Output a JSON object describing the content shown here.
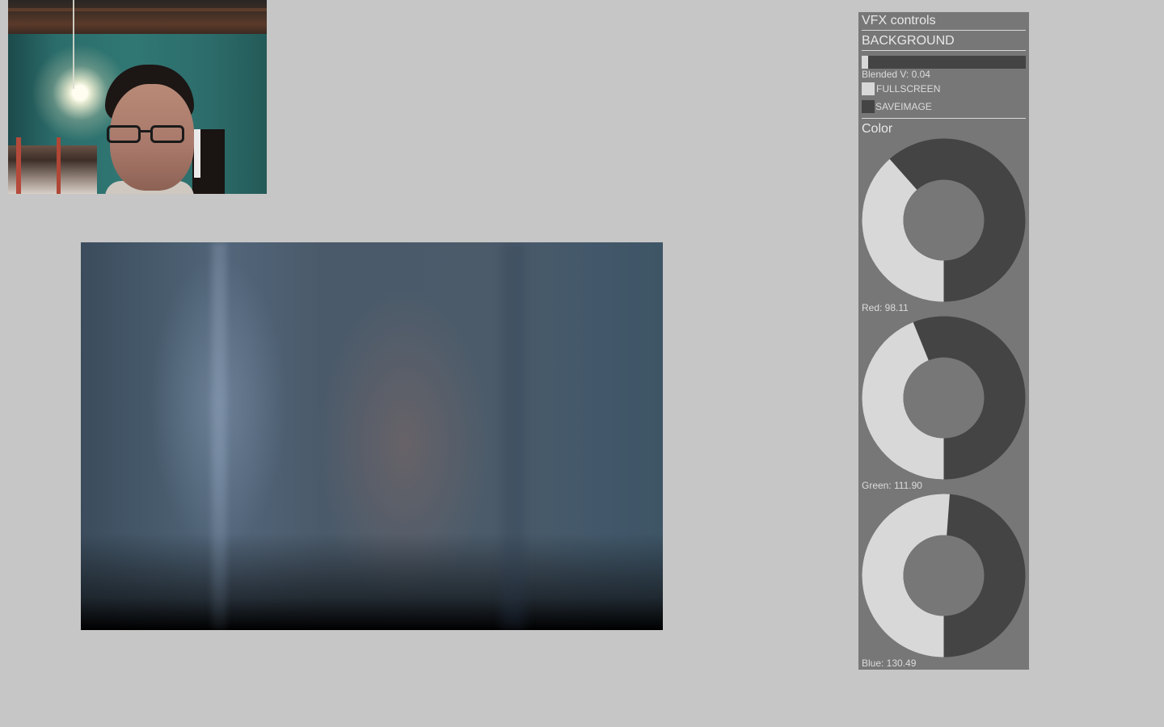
{
  "panel": {
    "title": "VFX controls",
    "section_background": "BACKGROUND",
    "blended": {
      "label": "Blended V: 0.04",
      "value": 0.04
    },
    "fullscreen": {
      "label": "FULLSCREEN",
      "checked": true
    },
    "saveimage": {
      "label": "SAVEIMAGE",
      "checked": false
    },
    "section_color": "Color",
    "red": {
      "label": "Red: 98.11",
      "value": 98.11
    },
    "green": {
      "label": "Green: 111.90",
      "value": 111.9
    },
    "blue": {
      "label": "Blue: 130.49",
      "value": 130.49
    }
  },
  "colors": {
    "app_background": "#c6c6c6",
    "panel_bg": "#777777",
    "widget_fill": "#d8d8d8",
    "widget_track": "#444444"
  }
}
